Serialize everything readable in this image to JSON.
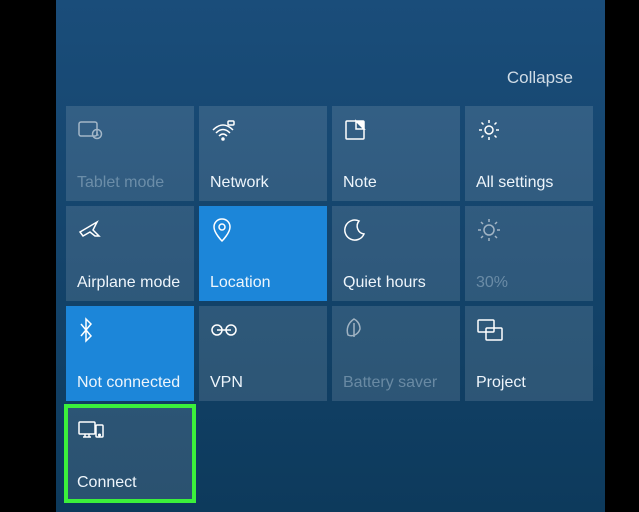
{
  "header": {
    "collapse": "Collapse"
  },
  "tiles": {
    "tablet_mode": "Tablet mode",
    "network": "Network",
    "note": "Note",
    "all_settings": "All settings",
    "airplane_mode": "Airplane mode",
    "location": "Location",
    "quiet_hours": "Quiet hours",
    "brightness": "30%",
    "bluetooth": "Not connected",
    "vpn": "VPN",
    "battery_saver": "Battery saver",
    "project": "Project",
    "connect": "Connect"
  }
}
